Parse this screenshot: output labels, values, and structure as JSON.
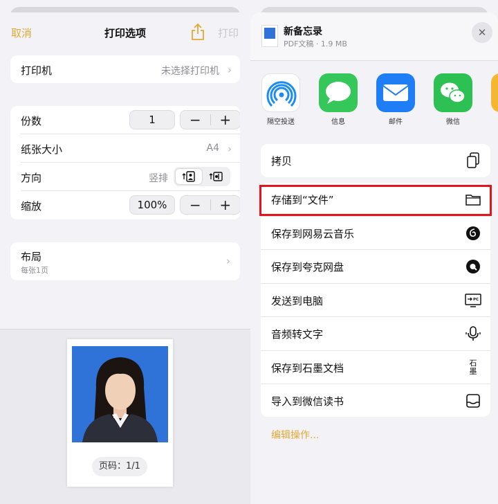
{
  "print": {
    "cancel": "取消",
    "title": "打印选项",
    "print": "打印",
    "printer_label": "打印机",
    "printer_value": "未选择打印机",
    "copies_label": "份数",
    "copies_value": "1",
    "paper_label": "纸张大小",
    "paper_value": "A4",
    "orientation_label": "方向",
    "orientation_value": "竖排",
    "scale_label": "缩放",
    "scale_value": "100%",
    "layout_label": "布局",
    "layout_sub": "每张1页",
    "page_label": "页码：1/1"
  },
  "share": {
    "doc_title": "新备忘录",
    "doc_sub": "PDF文稿 · 1.9 MB",
    "apps": [
      {
        "name": "隔空投送",
        "icon": "airdrop-icon",
        "color": "#1c8cf5"
      },
      {
        "name": "信息",
        "icon": "messages-icon",
        "color": "#35c759"
      },
      {
        "name": "邮件",
        "icon": "mail-icon",
        "color": "#1f7ef5"
      },
      {
        "name": "微信",
        "icon": "wechat-icon",
        "color": "#2dc153"
      }
    ],
    "actions": [
      {
        "label": "拷贝",
        "icon": "copy-icon"
      },
      {
        "label": "存储到“文件”",
        "icon": "folder-icon"
      },
      {
        "label": "保存到网易云音乐",
        "icon": "netease-music-icon"
      },
      {
        "label": "保存到夸克网盘",
        "icon": "quark-icon"
      },
      {
        "label": "发送到电脑",
        "icon": "send-to-pc-icon"
      },
      {
        "label": "音频转文字",
        "icon": "audio-to-text-icon"
      },
      {
        "label": "保存到石墨文档",
        "icon": "shimo-icon",
        "icon_text": "石墨"
      },
      {
        "label": "导入到微信读书",
        "icon": "wechat-read-icon"
      }
    ],
    "edit_actions": "编辑操作..."
  },
  "colors": {
    "accent": "#e0a935",
    "highlight_border": "#e3141c",
    "photo_background": "#2f72d8"
  }
}
